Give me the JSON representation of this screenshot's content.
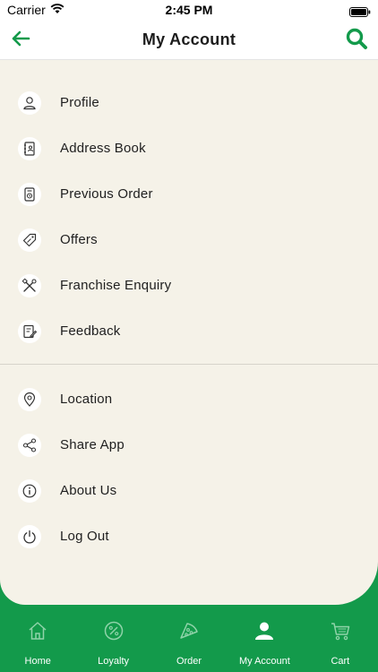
{
  "status_bar": {
    "carrier": "Carrier",
    "time": "2:45 PM"
  },
  "header": {
    "title": "My Account",
    "back_icon": "arrow-left-icon",
    "search_icon": "search-icon"
  },
  "colors": {
    "brand_green": "#139a4b",
    "content_bg": "#f5f2e8"
  },
  "menu": {
    "group1": [
      {
        "label": "Profile",
        "icon": "user-icon"
      },
      {
        "label": "Address Book",
        "icon": "address-book-icon"
      },
      {
        "label": "Previous Order",
        "icon": "order-history-icon"
      },
      {
        "label": "Offers",
        "icon": "offer-tag-icon"
      },
      {
        "label": "Franchise Enquiry",
        "icon": "tools-icon"
      },
      {
        "label": "Feedback",
        "icon": "feedback-icon"
      }
    ],
    "group2": [
      {
        "label": "Location",
        "icon": "location-pin-icon"
      },
      {
        "label": "Share App",
        "icon": "share-icon"
      },
      {
        "label": "About Us",
        "icon": "info-icon"
      },
      {
        "label": "Log Out",
        "icon": "power-icon"
      }
    ]
  },
  "tabbar": {
    "items": [
      {
        "label": "Home",
        "icon": "home-icon",
        "active": false
      },
      {
        "label": "Loyalty",
        "icon": "percent-badge-icon",
        "active": false
      },
      {
        "label": "Order",
        "icon": "pizza-slice-icon",
        "active": false
      },
      {
        "label": "My Account",
        "icon": "user-icon",
        "active": true
      },
      {
        "label": "Cart",
        "icon": "cart-icon",
        "active": false
      }
    ]
  }
}
